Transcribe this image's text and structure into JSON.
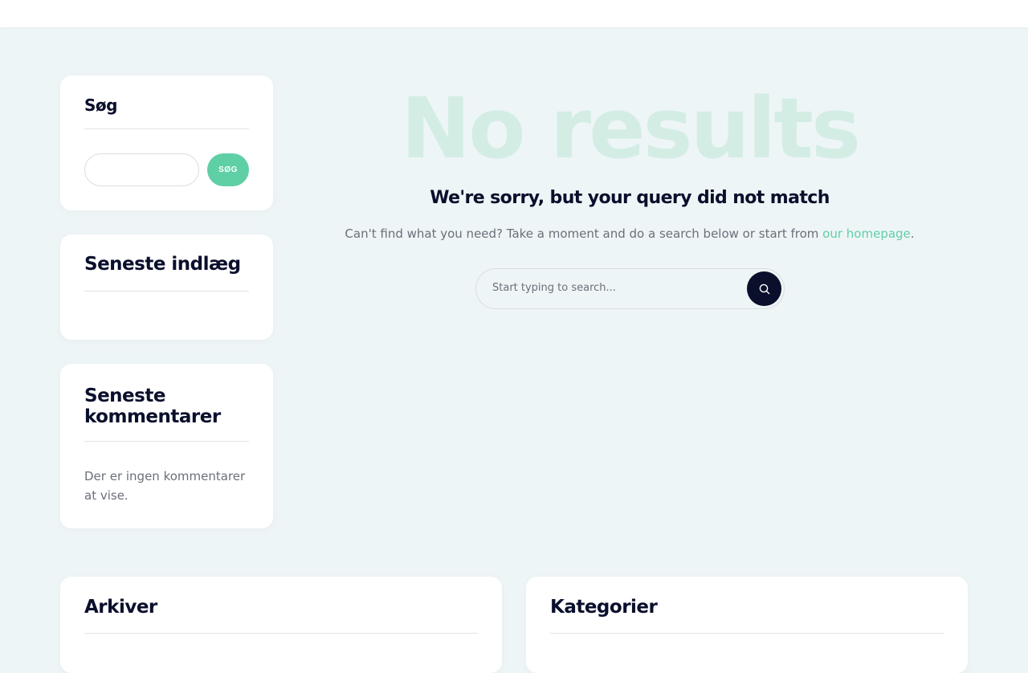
{
  "sidebar": {
    "search_widget": {
      "title": "Søg",
      "button_label": "SØG",
      "input_value": ""
    },
    "recent_posts": {
      "title": "Seneste indlæg"
    },
    "recent_comments": {
      "title": "Seneste kommentarer",
      "empty_text": "Der er ingen kommentarer at vise."
    }
  },
  "main": {
    "big_heading": "No results",
    "sub_heading": "We're sorry, but your query did not match",
    "description_before": "Can't find what you need? Take a moment and do a search below or start from ",
    "description_link": "our homepage",
    "description_after": ".",
    "search_placeholder": "Start typing to search..."
  },
  "footer_widgets": {
    "archive_title": "Arkiver",
    "categories_title": "Kategorier"
  },
  "colors": {
    "accent": "#5fcfa6",
    "dark": "#0a0f2c",
    "heading_faint": "#d3ede5",
    "background": "#eef5f6"
  }
}
